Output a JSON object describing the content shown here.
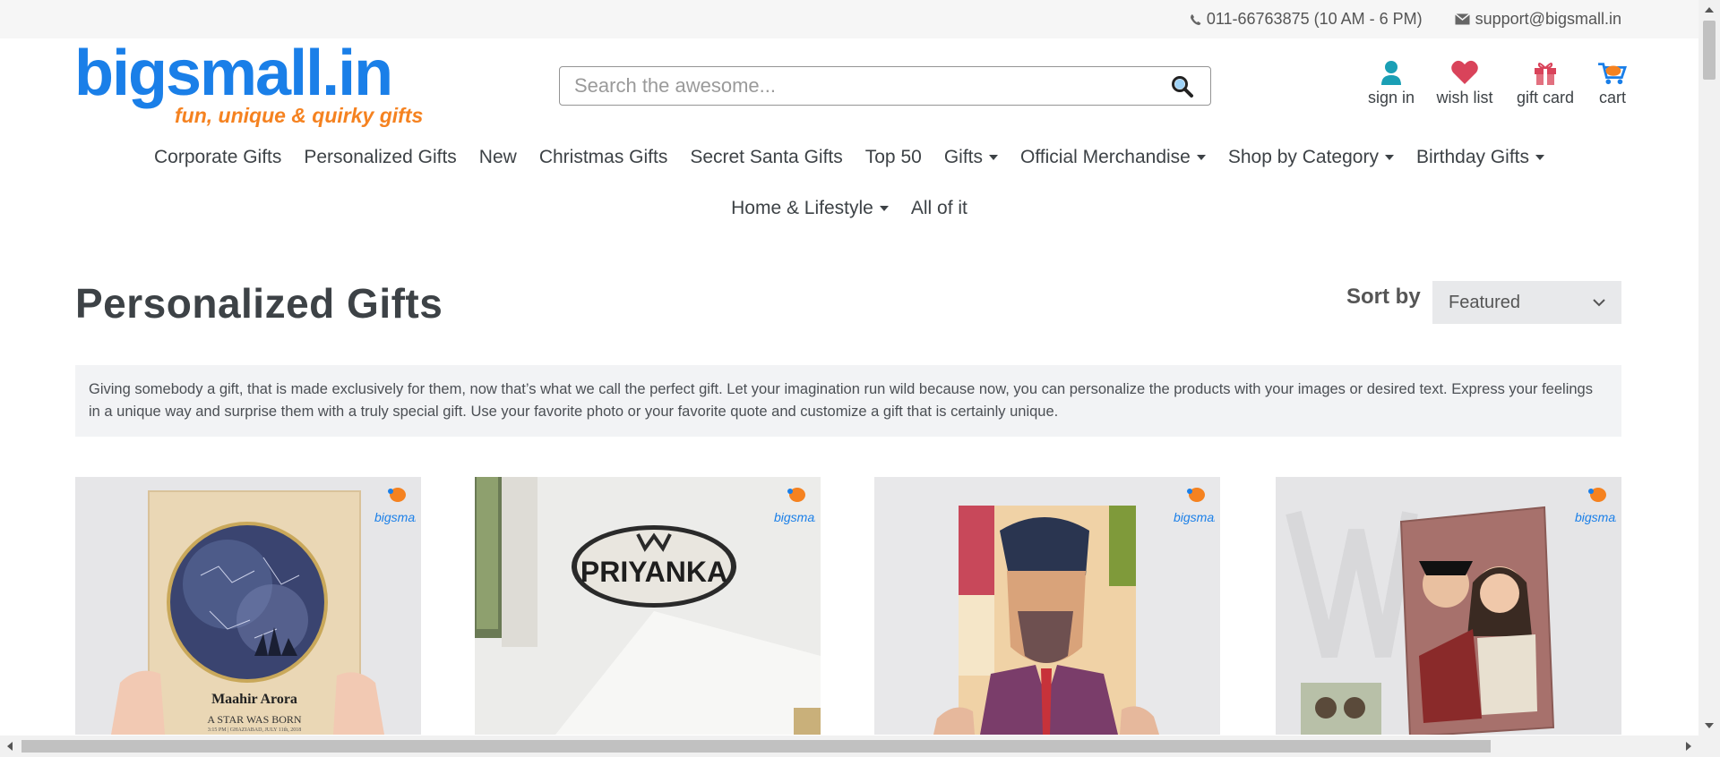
{
  "topbar": {
    "phone": "011-66763875 (10 AM - 6 PM)",
    "email": "support@bigsmall.in"
  },
  "logo": {
    "wordmark": "bigsmall.in",
    "tagline": "fun, unique & quirky gifts"
  },
  "search": {
    "placeholder": "Search the awesome..."
  },
  "header_icons": {
    "sign_in": "sign in",
    "wish_list": "wish list",
    "gift_card": "gift card",
    "cart": "cart"
  },
  "nav": {
    "row1": [
      {
        "label": "Corporate Gifts",
        "dropdown": false
      },
      {
        "label": "Personalized Gifts",
        "dropdown": false
      },
      {
        "label": "New",
        "dropdown": false
      },
      {
        "label": "Christmas Gifts",
        "dropdown": false
      },
      {
        "label": "Secret Santa Gifts",
        "dropdown": false
      },
      {
        "label": "Top 50",
        "dropdown": false
      },
      {
        "label": "Gifts",
        "dropdown": true
      },
      {
        "label": "Official Merchandise",
        "dropdown": true
      },
      {
        "label": "Shop by Category",
        "dropdown": true
      },
      {
        "label": "Birthday Gifts",
        "dropdown": true
      }
    ],
    "row2": [
      {
        "label": "Home & Lifestyle",
        "dropdown": true
      },
      {
        "label": "All of it",
        "dropdown": false
      }
    ]
  },
  "page": {
    "title": "Personalized Gifts",
    "sort_label": "Sort by",
    "sort_value": "Featured",
    "description": "Giving somebody a gift, that is made exclusively for them, now that’s what we call the perfect gift. Let your imagination run wild because now, you can personalize the products with your images or desired text. Express your feelings in a unique way and surprise them with a truly special gift. Use your favorite photo or your favorite quote and customize a gift that is certainly unique."
  },
  "products": [
    {
      "image_text_1": "Maahir Arora",
      "image_text_2": "A STAR WAS BORN",
      "image_text_3": "3:15 PM | GHAZIABAD, JULY 11th, 2018"
    },
    {
      "image_text_1": "PRIYANKA"
    },
    {},
    {}
  ],
  "colors": {
    "brand_blue": "#1a7fe8",
    "brand_orange": "#f58220",
    "text": "#3d4246",
    "teal_icon": "#1a9fb5",
    "heart": "#d9435a"
  }
}
